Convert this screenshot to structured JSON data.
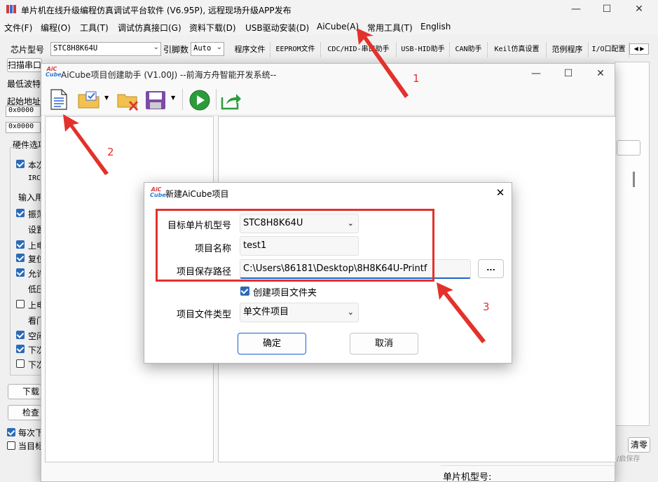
{
  "main_window": {
    "title": "单片机在线升级编程仿真调试平台软件 (V6.95P), 远程现场升级APP发布",
    "menu": [
      "文件(F)",
      "编程(O)",
      "工具(T)",
      "调试仿真接口(G)",
      "资料下载(D)",
      "USB驱动安装(D)",
      "AiCube(A)",
      "常用工具(T)",
      "English"
    ],
    "left": {
      "chip_label": "芯片型号",
      "chip_value": "STC8H8K64U",
      "pins_label": "引脚数",
      "pins_value": "Auto",
      "scan_label": "扫描串口",
      "min_wave_label": "最低波特",
      "start_addr_label": "起始地址",
      "addr1": "0x0000",
      "addr2": "0x0000",
      "hw_options_label": "硬件选项",
      "opts": [
        "本次",
        "IRC",
        "输入用",
        "振荡",
        "设置",
        "上电",
        "复位",
        "允许",
        "低压",
        "上电",
        "看门",
        "空闲",
        "下次",
        "下次"
      ],
      "download_btn": "下载",
      "check_btn": "检查",
      "each_label": "每次下",
      "current_label": "当目标"
    },
    "tabs": [
      "程序文件",
      "EEPROM文件",
      "CDC/HID-串口助手",
      "USB-HID助手",
      "CAN助手",
      "Keil仿真设置",
      "范例程序",
      "I/O口配置"
    ],
    "clear_btn": "清零",
    "status_bar": {
      "chip_model_label": "单片机型号:",
      "extra": "/启保存"
    }
  },
  "aicube_window": {
    "title": "AiCube项目创建助手 (V1.00J) --前海方舟智能开发系统--",
    "logo_text": "AiC Cube"
  },
  "dialog": {
    "title": "新建AiCube项目",
    "target_label": "目标单片机型号",
    "target_value": "STC8H8K64U",
    "name_label": "项目名称",
    "name_value": "test1",
    "path_label": "项目保存路径",
    "path_value": "C:\\Users\\86181\\Desktop\\8H8K64U-Printf",
    "browse_label": "...",
    "create_folder_label": "创建项目文件夹",
    "filetype_label": "项目文件类型",
    "filetype_value": "单文件项目",
    "ok_label": "确定",
    "cancel_label": "取消"
  },
  "annotations": {
    "n1": "1",
    "n2": "2",
    "n3": "3"
  },
  "colors": {
    "annotation_red": "#e3312b",
    "check_blue": "#2b6ab8",
    "accent_blue": "#1a64c8"
  }
}
